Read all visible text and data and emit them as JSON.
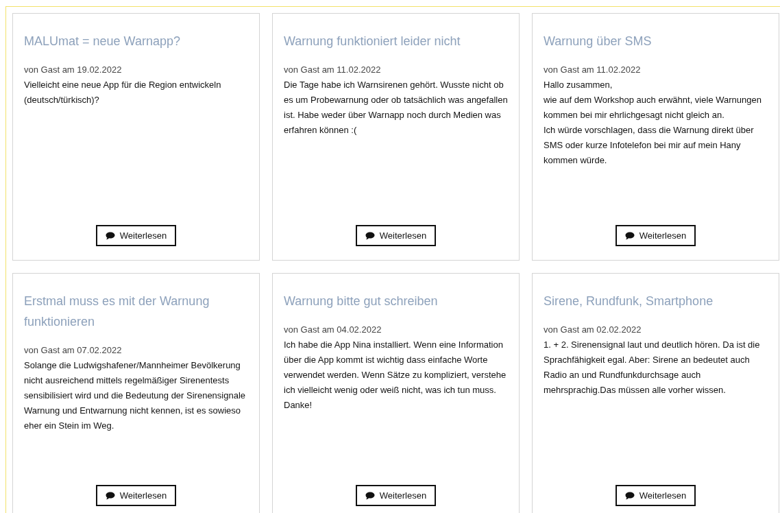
{
  "posts": [
    {
      "title": "MALUmat = neue Warnapp?",
      "meta": "von Gast am 19.02.2022",
      "body": "Vielleicht eine neue App für die Region entwickeln (deutsch/türkisch)?",
      "button": "Weiterlesen"
    },
    {
      "title": "Warnung funktioniert leider nicht",
      "meta": "von Gast am 11.02.2022",
      "body": "Die Tage habe ich Warnsirenen gehört. Wusste nicht ob es um Probewarnung oder ob tatsächlich was angefallen ist. Habe weder über Warnapp noch durch Medien was erfahren können :(",
      "button": "Weiterlesen"
    },
    {
      "title": "Warnung über SMS",
      "meta": "von Gast am 11.02.2022",
      "body": "Hallo zusammen,\nwie auf dem Workshop auch erwähnt, viele Warnungen kommen bei mir ehrlichgesagt nicht gleich an.\nIch würde vorschlagen, dass die Warnung direkt über SMS oder kurze Infotelefon bei mir auf mein Hany kommen würde.",
      "button": "Weiterlesen"
    },
    {
      "title": "Erstmal muss es mit der Warnung funktionieren",
      "meta": "von Gast am 07.02.2022",
      "body": "Solange die Ludwigshafener/Mannheimer Bevölkerung nicht ausreichend mittels regelmäßiger Sirenentests sensibilisiert wird und die Bedeutung der Sirenensignale Warnung und Entwarnung nicht kennen, ist es sowieso eher ein Stein im Weg.",
      "button": "Weiterlesen"
    },
    {
      "title": "Warnung bitte gut schreiben",
      "meta": "von Gast am 04.02.2022",
      "body": "Ich habe die App Nina installiert. Wenn eine Information über die App kommt ist wichtig dass einfache Worte verwendet werden. Wenn Sätze zu kompliziert, verstehe ich vielleicht wenig oder weiß nicht, was ich tun muss. Danke!",
      "button": "Weiterlesen"
    },
    {
      "title": "Sirene, Rundfunk, Smartphone",
      "meta": "von Gast am 02.02.2022",
      "body": "1. + 2. Sirenensignal laut und deutlich hören. Da ist die Sprachfähigkeit egal. Aber: Sirene an bedeutet auch Radio an und Rundfunkdurchsage auch mehrsprachig.Das müssen alle vorher wissen.",
      "button": "Weiterlesen"
    }
  ]
}
